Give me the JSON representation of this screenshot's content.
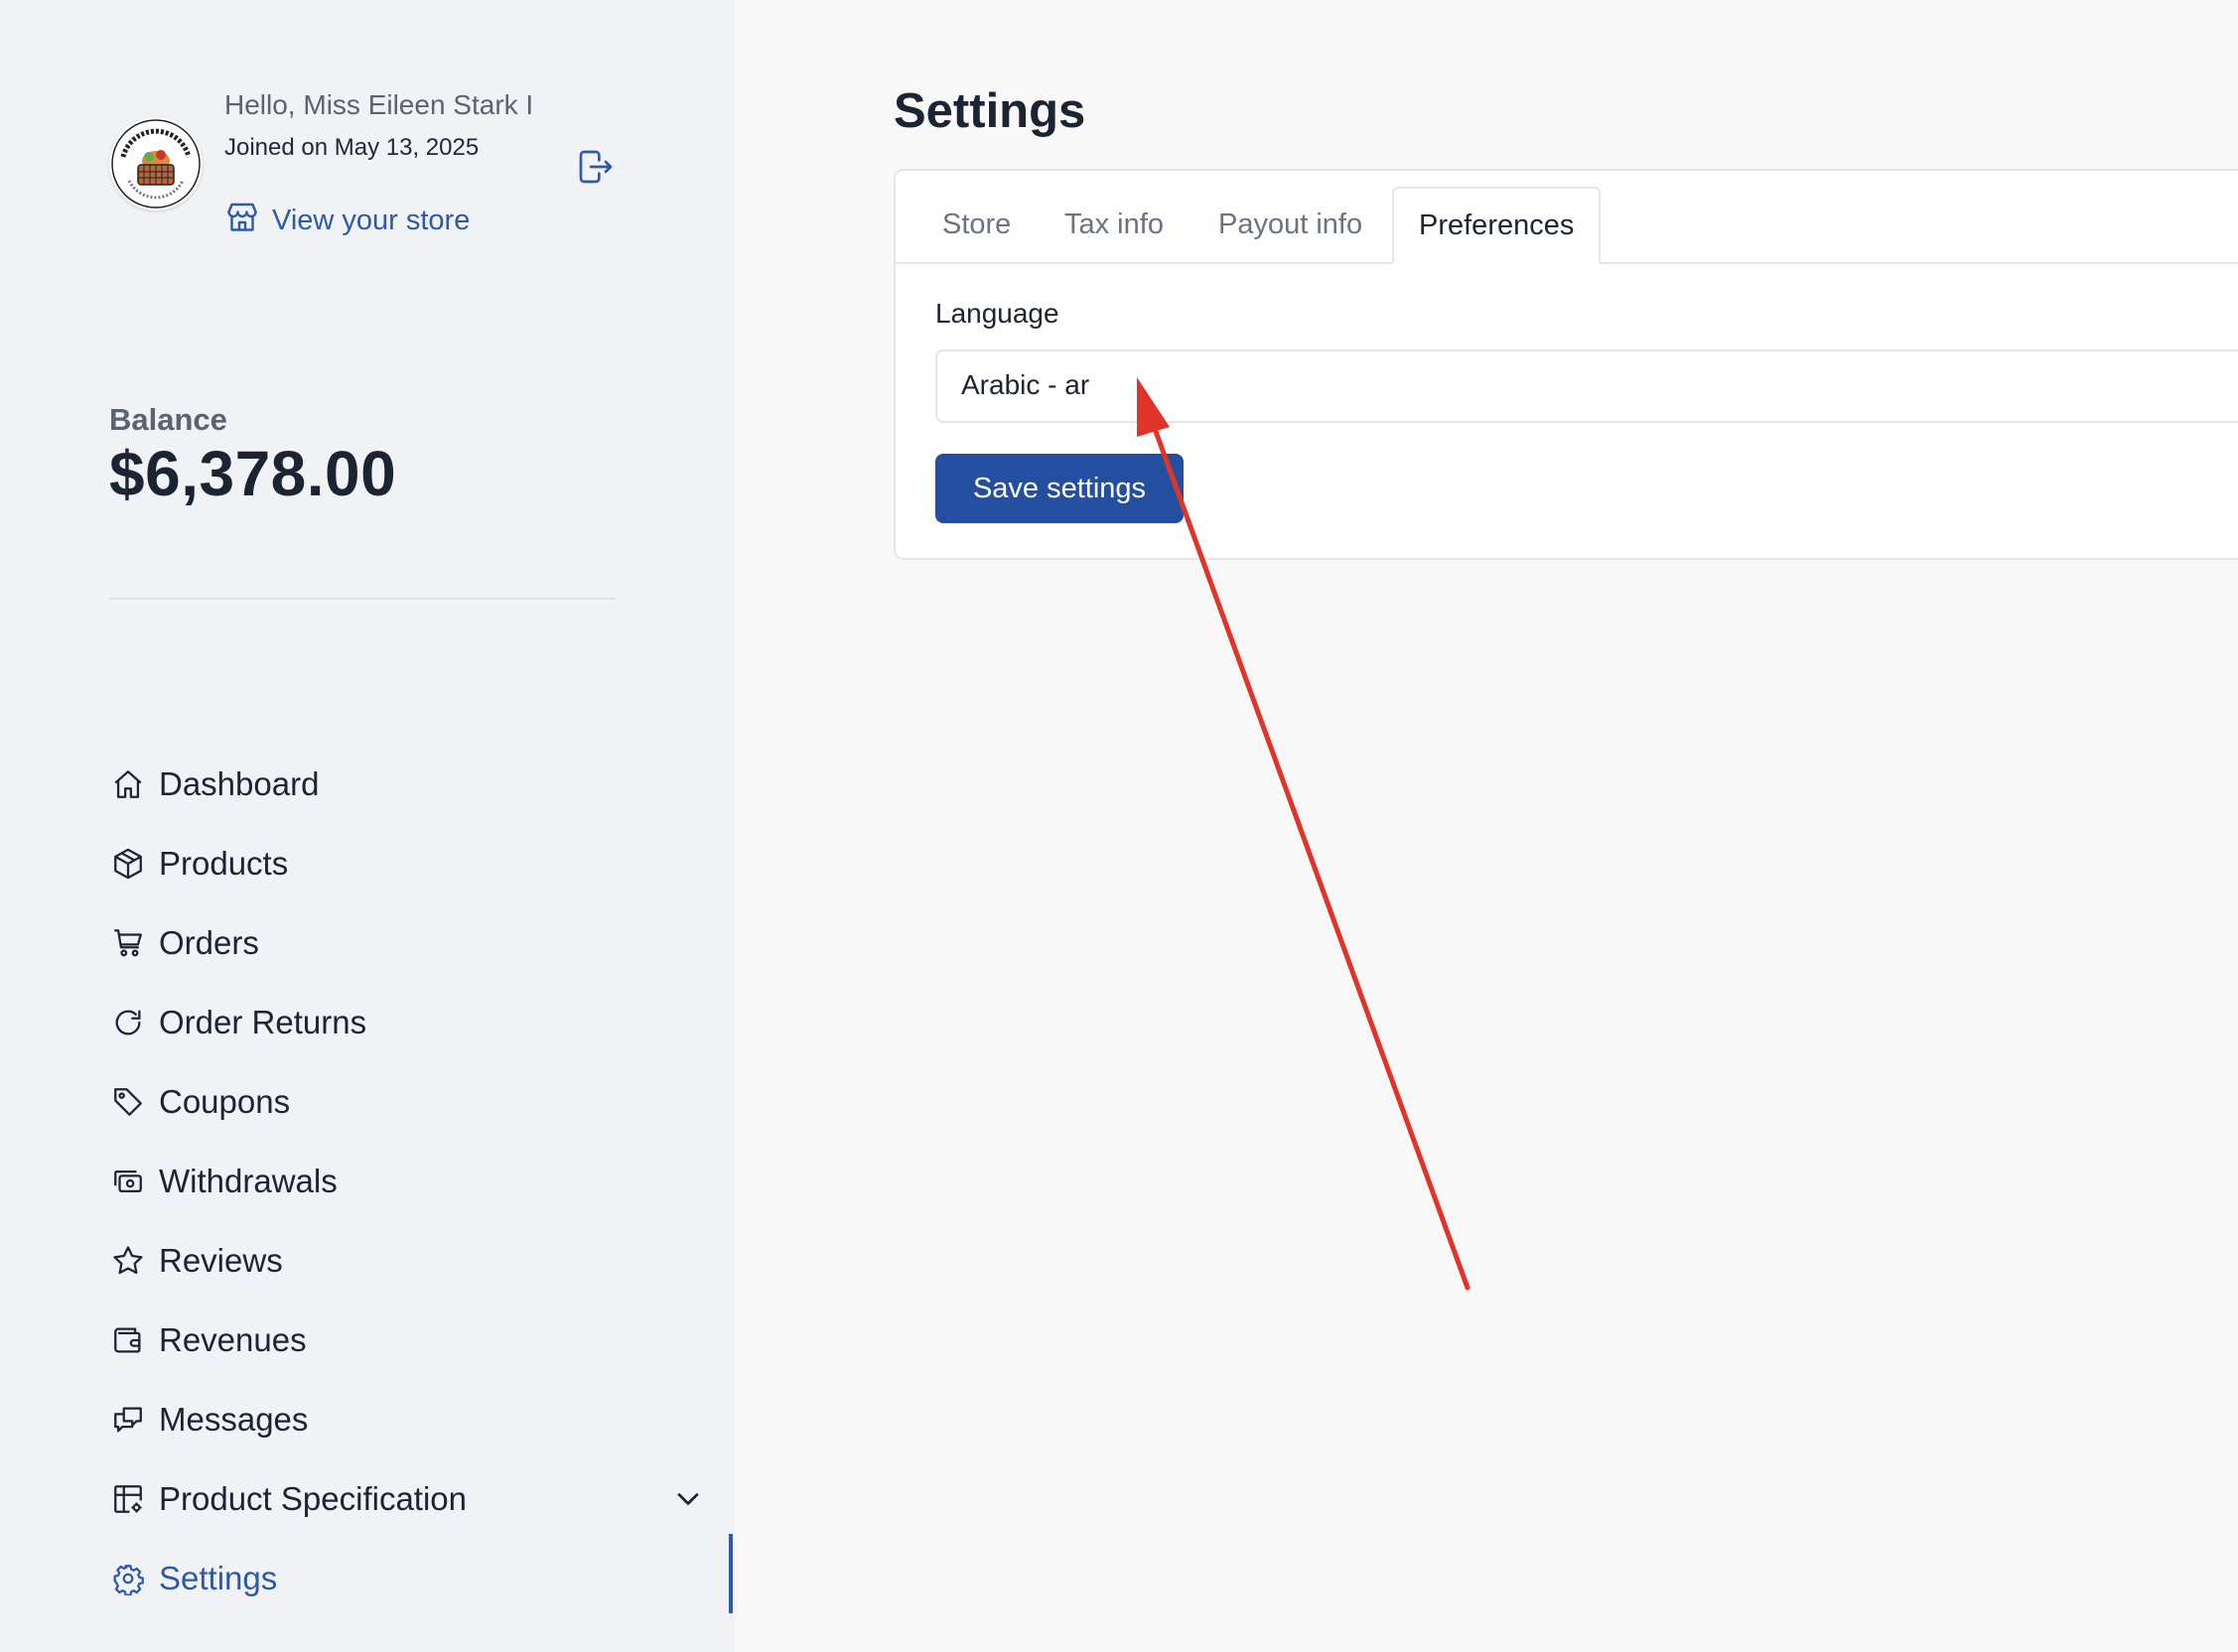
{
  "profile": {
    "greeting": "Hello, Miss Eileen Stark I",
    "joined": "Joined on May 13, 2025",
    "view_store": "View your store",
    "logo_text": "NATURE FOOD"
  },
  "balance": {
    "label": "Balance",
    "value": "$6,378.00"
  },
  "nav": {
    "items": [
      {
        "label": "Dashboard",
        "icon": "home-icon"
      },
      {
        "label": "Products",
        "icon": "cube-icon"
      },
      {
        "label": "Orders",
        "icon": "cart-icon"
      },
      {
        "label": "Order Returns",
        "icon": "refresh-icon"
      },
      {
        "label": "Coupons",
        "icon": "tag-icon"
      },
      {
        "label": "Withdrawals",
        "icon": "cash-icon"
      },
      {
        "label": "Reviews",
        "icon": "star-icon"
      },
      {
        "label": "Revenues",
        "icon": "wallet-icon"
      },
      {
        "label": "Messages",
        "icon": "messages-icon"
      },
      {
        "label": "Product Specification",
        "icon": "table-settings-icon"
      },
      {
        "label": "Settings",
        "icon": "gear-icon"
      }
    ],
    "active": "Settings"
  },
  "main": {
    "title": "Settings",
    "tabs": [
      {
        "label": "Store"
      },
      {
        "label": "Tax info"
      },
      {
        "label": "Payout info"
      },
      {
        "label": "Preferences"
      }
    ],
    "active_tab": "Preferences",
    "language_label": "Language",
    "language_value": "Arabic - ar",
    "save_label": "Save settings"
  },
  "colors": {
    "accent": "#2d5aa8",
    "button": "#244fa0",
    "arrow": "#e0342a"
  }
}
